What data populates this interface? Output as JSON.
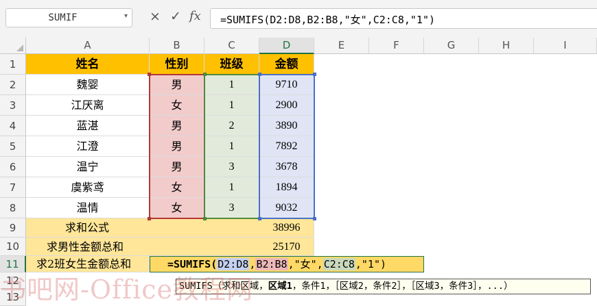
{
  "formula_bar": {
    "name_box": "SUMIF",
    "cancel_icon": "×",
    "enter_icon": "✓",
    "fx_label": "fx",
    "formula": "=SUMIFS(D2:D8,B2:B8,\"女\",C2:C8,\"1\")"
  },
  "columns": [
    "A",
    "B",
    "C",
    "D",
    "E",
    "F",
    "G",
    "H",
    "I"
  ],
  "rows": [
    "1",
    "2",
    "3",
    "4",
    "5",
    "6",
    "7",
    "8",
    "9",
    "10",
    "11",
    "12",
    "13"
  ],
  "table": {
    "headers": [
      "姓名",
      "性别",
      "班级",
      "金额"
    ],
    "records": [
      [
        "魏婴",
        "男",
        "1",
        "9710"
      ],
      [
        "江厌离",
        "女",
        "1",
        "2900"
      ],
      [
        "蓝湛",
        "男",
        "2",
        "3890"
      ],
      [
        "江澄",
        "男",
        "1",
        "7892"
      ],
      [
        "温宁",
        "男",
        "3",
        "3678"
      ],
      [
        "虞紫鸢",
        "女",
        "1",
        "1894"
      ],
      [
        "温情",
        "女",
        "3",
        "9032"
      ]
    ]
  },
  "summary": {
    "row9_label": "求和公式",
    "row9_value": "38996",
    "row10_label": "求男性金额总和",
    "row10_value": "25170",
    "row11_label": "求2班女生金额总和"
  },
  "editing": {
    "func": "=SUMIFS(",
    "ref1": "D2:D8",
    "sep1": ",",
    "ref2": "B2:B8",
    "mid": ",\"女\",",
    "ref3": "C2:C8",
    "tail": ",\"1\")"
  },
  "tooltip": {
    "func": "SUMIFS",
    "open": "（求和区域，",
    "bold_arg": "区域1",
    "rest": "，条件1，［区域2，条件2］，［区域3，条件3］，...）"
  },
  "watermark": "书吧网-Office教程网",
  "colors": {
    "header_fill": "#ffc000",
    "summary_fill": "#ffe699",
    "edit_fill": "#ffd966",
    "range_b": "#b03838",
    "range_c": "#4e8a3a",
    "range_d": "#4a6fc6"
  }
}
